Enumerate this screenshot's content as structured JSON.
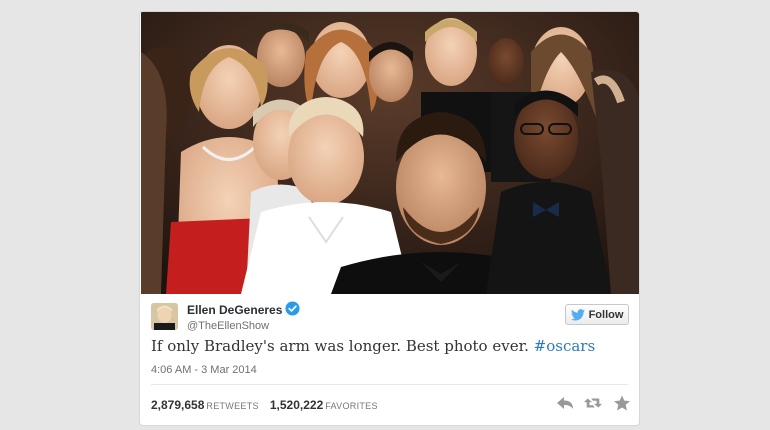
{
  "tweet": {
    "author_name": "Ellen DeGeneres",
    "author_handle": "@TheEllenShow",
    "text": "If only Bradley's arm was longer. Best photo ever. ",
    "hashtag": "#oscars",
    "timestamp": "4:06 AM - 3 Mar 2014",
    "retweets_count": "2,879,658",
    "retweets_label": "RETWEETS",
    "favorites_count": "1,520,222",
    "favorites_label": "FAVORITES"
  },
  "follow_button": {
    "label": "Follow",
    "icon": "twitter-bird-icon"
  },
  "actions": [
    {
      "icon": "reply-icon"
    },
    {
      "icon": "retweet-icon"
    },
    {
      "icon": "favorite-star-icon"
    }
  ],
  "colors": {
    "link": "#2b7bb9",
    "verified": "#2b9be8",
    "twitter_blue": "#55acee",
    "action_gray": "#999999"
  }
}
